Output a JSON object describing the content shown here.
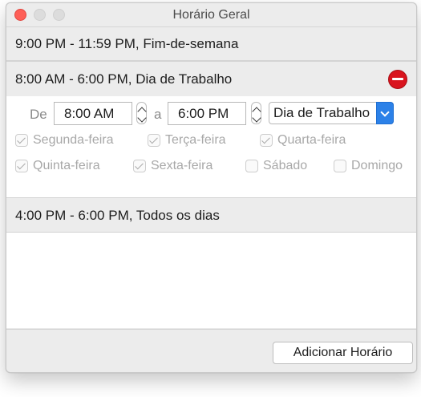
{
  "window": {
    "title": "Horário Geral"
  },
  "schedules": [
    {
      "label": "9:00 PM - 11:59 PM, Fim-de-semana"
    },
    {
      "label": "8:00 AM - 6:00 PM, Dia de Trabalho"
    },
    {
      "label": "4:00 PM - 6:00 PM, Todos os dias"
    }
  ],
  "editor": {
    "from_label": "De",
    "from_value": "8:00 AM",
    "to_label": "a",
    "to_value": "6:00 PM",
    "preset_value": "Dia de Trabalho",
    "days": [
      {
        "label": "Segunda-feira",
        "checked": true
      },
      {
        "label": "Terça-feira",
        "checked": true
      },
      {
        "label": "Quarta-feira",
        "checked": true
      },
      {
        "label": "Quinta-feira",
        "checked": true
      },
      {
        "label": "Sexta-feira",
        "checked": true
      },
      {
        "label": "Sábado",
        "checked": false
      },
      {
        "label": "Domingo",
        "checked": false
      }
    ]
  },
  "footer": {
    "add_label": "Adicionar Horário"
  },
  "colors": {
    "remove": "#d9141e",
    "accent": "#2c81e8",
    "close": "#fe5f57"
  },
  "icons": {
    "remove": "minus-circle-icon",
    "stepper": "up-down-stepper-icon",
    "popup": "chevron-down-icon"
  }
}
